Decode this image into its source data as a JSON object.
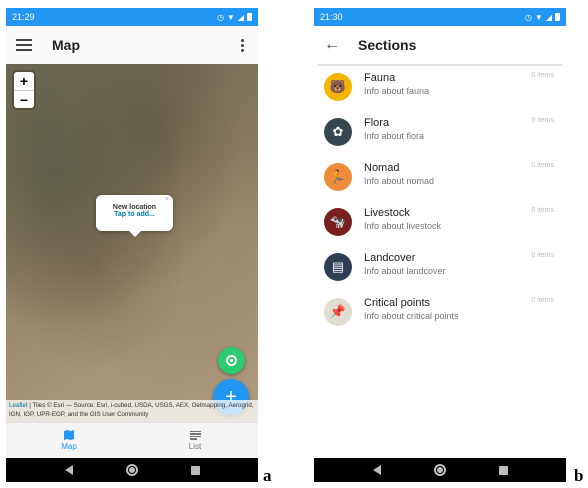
{
  "panel_a": {
    "status_time": "21:29",
    "title": "Map",
    "zoom_in": "+",
    "zoom_out": "−",
    "popup": {
      "title": "New location",
      "link": "Tap to add...",
      "close": "×"
    },
    "fab_add": "+",
    "attribution": {
      "leaflet": "Leaflet",
      "text": " | Tiles © Esri — Source: Esri, i-cubed, USDA, USGS, AEX, Getmapping, Aerogrid, IGN, IGP, UPR-EGP, and the GIS User Community"
    },
    "nav": {
      "map": "Map",
      "list": "List"
    },
    "label": "a"
  },
  "panel_b": {
    "status_time": "21:30",
    "title": "Sections",
    "sections": [
      {
        "title": "Fauna",
        "subtitle": "Info about fauna",
        "count": "0 items",
        "color": "#f5b400",
        "icon": "bear-icon",
        "glyph": "🐻"
      },
      {
        "title": "Flora",
        "subtitle": "Info about flora",
        "count": "0 items",
        "color": "#37474f",
        "icon": "flower-icon",
        "glyph": "✿"
      },
      {
        "title": "Nomad",
        "subtitle": "Info about nomad",
        "count": "0 items",
        "color": "#ef8c3a",
        "icon": "running-person-icon",
        "glyph": "🏃"
      },
      {
        "title": "Livestock",
        "subtitle": "Info about livestock",
        "count": "0 items",
        "color": "#7a1f1f",
        "icon": "cow-icon",
        "glyph": "🐄"
      },
      {
        "title": "Landcover",
        "subtitle": "Info about landcover",
        "count": "0 items",
        "color": "#2f3e55",
        "icon": "layers-icon",
        "glyph": "▤"
      },
      {
        "title": "Critical points",
        "subtitle": "Info about critical points",
        "count": "0 items",
        "color": "#e0dccf",
        "icon": "pushpin-icon",
        "glyph": "📌"
      }
    ],
    "label": "b"
  }
}
